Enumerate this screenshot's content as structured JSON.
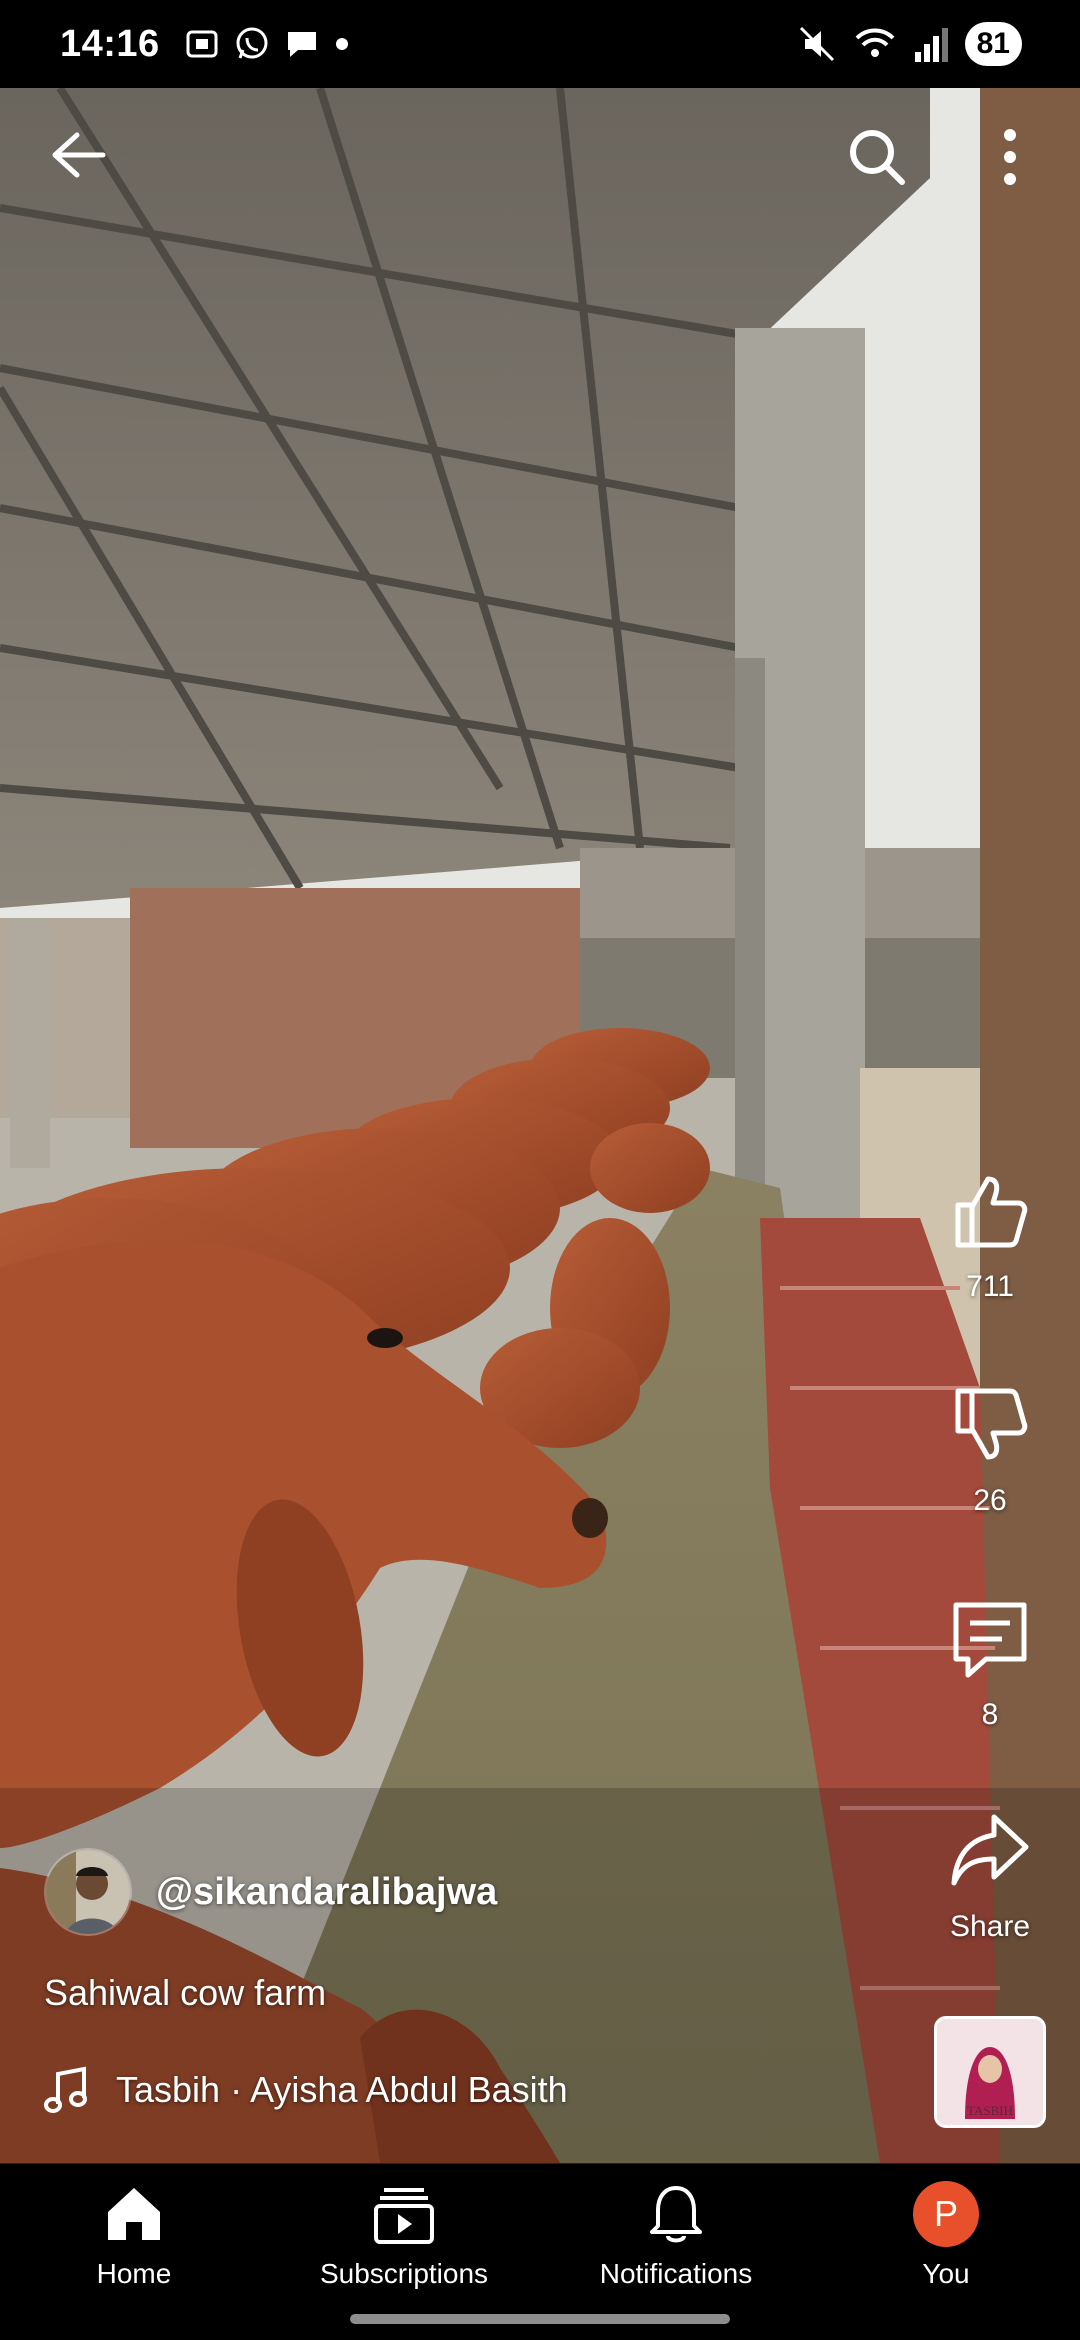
{
  "status_bar": {
    "time": "14:16",
    "battery": "81",
    "left_icons": [
      "screenshot-icon",
      "whatsapp-icon",
      "message-icon",
      "dot-icon"
    ],
    "right_icons": [
      "mute-icon",
      "wifi-icon",
      "signal-icon"
    ]
  },
  "top_bar": {
    "back_icon": "back-arrow-icon",
    "search_icon": "search-icon",
    "more_icon": "more-vert-icon"
  },
  "actions": {
    "like_count": "711",
    "dislike_count": "26",
    "comment_count": "8",
    "share_label": "Share"
  },
  "video": {
    "channel_handle": "@sikandaralibajwa",
    "title": "Sahiwal cow farm",
    "music": "Tasbih · Ayisha Abdul Basith",
    "music_thumb_text": "TASBIH"
  },
  "bottom_nav": {
    "items": [
      {
        "label": "Home",
        "icon": "home-icon"
      },
      {
        "label": "Subscriptions",
        "icon": "subscriptions-icon"
      },
      {
        "label": "Notifications",
        "icon": "bell-icon"
      },
      {
        "label": "You",
        "icon": "profile-avatar",
        "initial": "P"
      }
    ]
  },
  "colors": {
    "background": "#000000",
    "avatar_you": "#e8502b",
    "cow": "#a9502e",
    "brick": "#a34a3c"
  }
}
